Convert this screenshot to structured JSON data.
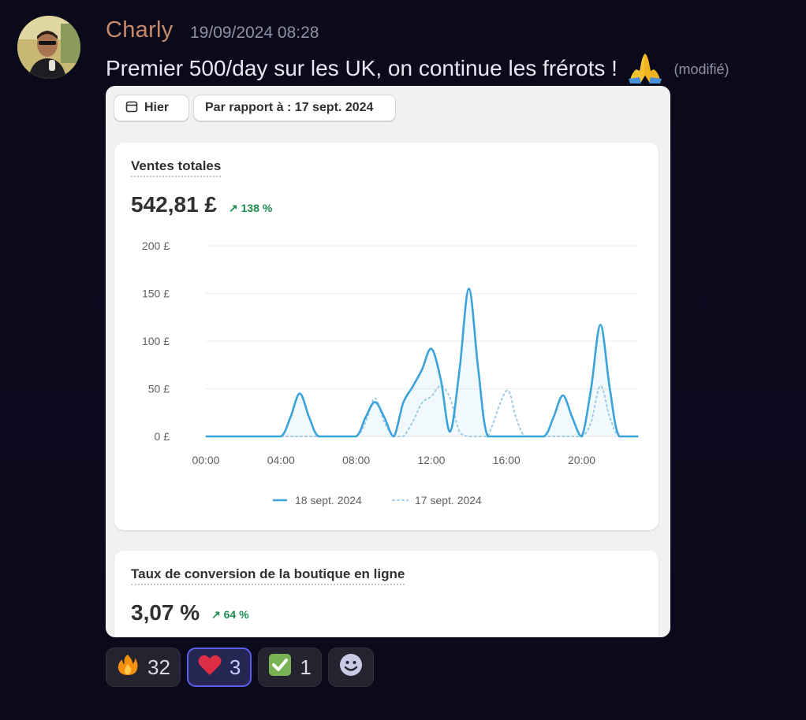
{
  "message": {
    "author": "Charly",
    "timestamp": "19/09/2024 08:28",
    "text": "Premier 500/day sur les UK, on continue les frérots !",
    "emoji_icon": "folded-hands-icon",
    "edited_label": "(modifié)"
  },
  "embed": {
    "filters": {
      "date_label": "Hier",
      "compare_label": "Par rapport à : 17 sept. 2024"
    },
    "sales_card": {
      "title": "Ventes totales",
      "value": "542,81 £",
      "delta": "138 %",
      "delta_color": "#1a8e4f"
    },
    "conversion_card": {
      "title": "Taux de conversion de la boutique en ligne",
      "value": "3,07 %",
      "delta": "64 %"
    }
  },
  "chart_data": {
    "type": "line",
    "title": "",
    "xlabel": "",
    "ylabel": "",
    "ylim": [
      0,
      200
    ],
    "y_ticks": [
      "0 £",
      "50 £",
      "100 £",
      "150 £",
      "200 £"
    ],
    "x_ticks": [
      "00:00",
      "04:00",
      "08:00",
      "12:00",
      "16:00",
      "20:00"
    ],
    "xlim": [
      0,
      23
    ],
    "grid": true,
    "legend_position": "bottom-center",
    "series": [
      {
        "name": "18 sept. 2024",
        "style": "solid",
        "color": "#3aa3d9",
        "x": [
          0,
          1,
          2,
          3,
          4,
          4.5,
          5,
          5.5,
          6,
          7,
          8,
          8.5,
          9,
          9.5,
          10,
          10.5,
          11,
          11.5,
          12,
          12.5,
          13,
          13.5,
          14,
          14.5,
          15,
          16,
          17,
          18,
          18.5,
          19,
          19.5,
          20,
          20.5,
          21,
          21.5,
          22,
          23
        ],
        "y": [
          0,
          0,
          0,
          0,
          0,
          20,
          45,
          20,
          0,
          0,
          0,
          20,
          36,
          20,
          0,
          35,
          52,
          70,
          92,
          60,
          5,
          70,
          155,
          70,
          0,
          0,
          0,
          0,
          20,
          43,
          20,
          0,
          50,
          117,
          50,
          0,
          0
        ]
      },
      {
        "name": "17 sept. 2024",
        "style": "dotted",
        "color": "#9dcbe6",
        "x": [
          0,
          1,
          2,
          3,
          4,
          4.5,
          5,
          5.5,
          6,
          7,
          8,
          8.5,
          9,
          9.5,
          10,
          10.5,
          11,
          11.5,
          12,
          12.5,
          13,
          13.5,
          14,
          14.5,
          15,
          16,
          16.5,
          17,
          18,
          19,
          20,
          20.5,
          21,
          21.5,
          22,
          23
        ],
        "y": [
          0,
          0,
          0,
          0,
          0,
          0,
          0,
          0,
          0,
          0,
          0,
          15,
          40,
          15,
          0,
          0,
          15,
          35,
          42,
          53,
          40,
          5,
          0,
          0,
          0,
          48,
          20,
          0,
          0,
          0,
          0,
          15,
          53,
          20,
          0,
          0
        ]
      }
    ]
  },
  "reactions": [
    {
      "icon": "fire-icon",
      "count": "32",
      "active": false
    },
    {
      "icon": "red-heart-icon",
      "count": "3",
      "active": true
    },
    {
      "icon": "check-mark-button-icon",
      "count": "1",
      "active": false
    }
  ],
  "add_reaction_icon": "add-reaction-smiley-icon"
}
